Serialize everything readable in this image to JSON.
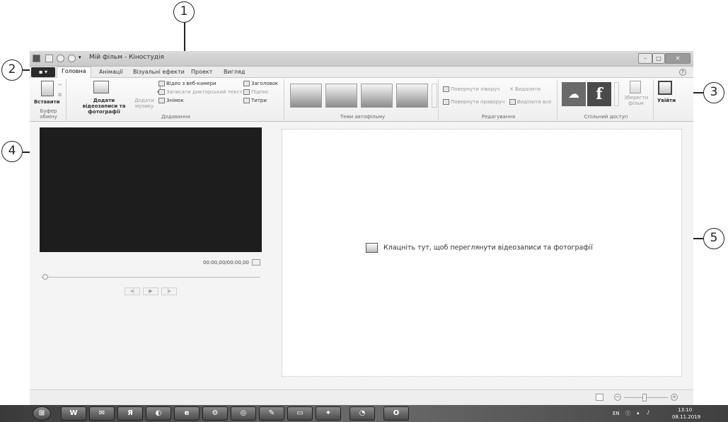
{
  "window": {
    "title": "Мій фільм - Кіностудія",
    "file_button": "▪ ▾",
    "tabs": [
      "Головна",
      "Анімації",
      "Візуальні ефекти",
      "Проект",
      "Вигляд"
    ],
    "active_tab": "Головна"
  },
  "ribbon": {
    "clipboard": {
      "paste": "Вставити",
      "label": "Буфер обміну"
    },
    "add": {
      "add_videos": "Додати відеозаписи та фотографії",
      "add_music": "Додати музику",
      "webcam": "Відео з веб-камери",
      "narration": "Записати дикторський текст",
      "snapshot": "Знімок",
      "title": "Заголовок",
      "caption": "Підпис",
      "credits": "Титри",
      "label": "Додавання"
    },
    "themes": {
      "label": "Теми автофільму"
    },
    "edit": {
      "rotate_left": "Повернути ліворуч",
      "rotate_right": "Повернути праворуч",
      "remove": "Видалити",
      "select_all": "Виділити все",
      "label": "Редагування"
    },
    "share": {
      "save_movie": "Зберегти фільм",
      "label": "Спільний доступ"
    },
    "sign_in": "Увійти"
  },
  "preview": {
    "timecode": "00:00,00/00:00,00"
  },
  "storyboard": {
    "hint": "Клацніть тут, щоб переглянути відеозаписи та фотографії"
  },
  "callouts": [
    "1",
    "2",
    "3",
    "4",
    "5"
  ],
  "taskbar": {
    "lang": "EN",
    "time": "13:10",
    "date": "08.11.2019",
    "apps": [
      "W",
      "Я",
      "e"
    ]
  }
}
